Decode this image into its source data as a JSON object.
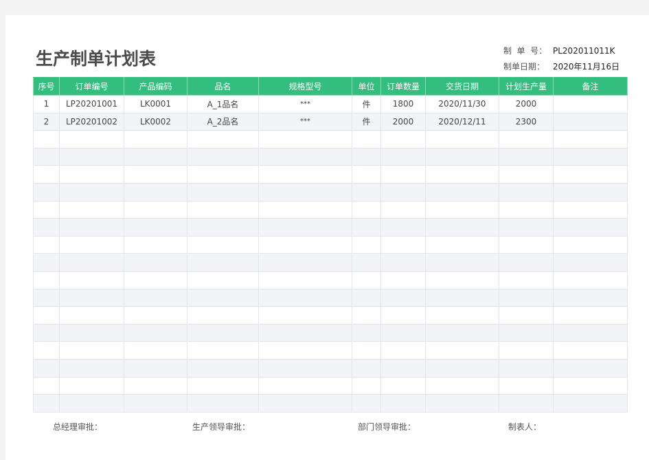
{
  "title": "生产制单计划表",
  "meta": {
    "order_no_label": "制  单  号：",
    "order_no": "PL202011011K",
    "date_label": "制单日期：",
    "date": "2020年11月16日"
  },
  "table": {
    "headers": [
      "序号",
      "订单编号",
      "产品编码",
      "品名",
      "规格型号",
      "单位",
      "订单数量",
      "交货日期",
      "计划生产量",
      "备注"
    ],
    "rows": [
      [
        "1",
        "LP20201001",
        "LK0001",
        "A_1品名",
        "***",
        "件",
        "1800",
        "2020/11/30",
        "2000",
        ""
      ],
      [
        "2",
        "LP20201002",
        "LK0002",
        "A_2品名",
        "***",
        "件",
        "2000",
        "2020/12/11",
        "2300",
        ""
      ],
      [
        "",
        "",
        "",
        "",
        "",
        "",
        "",
        "",
        "",
        ""
      ],
      [
        "",
        "",
        "",
        "",
        "",
        "",
        "",
        "",
        "",
        ""
      ],
      [
        "",
        "",
        "",
        "",
        "",
        "",
        "",
        "",
        "",
        ""
      ],
      [
        "",
        "",
        "",
        "",
        "",
        "",
        "",
        "",
        "",
        ""
      ],
      [
        "",
        "",
        "",
        "",
        "",
        "",
        "",
        "",
        "",
        ""
      ],
      [
        "",
        "",
        "",
        "",
        "",
        "",
        "",
        "",
        "",
        ""
      ],
      [
        "",
        "",
        "",
        "",
        "",
        "",
        "",
        "",
        "",
        ""
      ],
      [
        "",
        "",
        "",
        "",
        "",
        "",
        "",
        "",
        "",
        ""
      ],
      [
        "",
        "",
        "",
        "",
        "",
        "",
        "",
        "",
        "",
        ""
      ],
      [
        "",
        "",
        "",
        "",
        "",
        "",
        "",
        "",
        "",
        ""
      ],
      [
        "",
        "",
        "",
        "",
        "",
        "",
        "",
        "",
        "",
        ""
      ],
      [
        "",
        "",
        "",
        "",
        "",
        "",
        "",
        "",
        "",
        ""
      ],
      [
        "",
        "",
        "",
        "",
        "",
        "",
        "",
        "",
        "",
        ""
      ],
      [
        "",
        "",
        "",
        "",
        "",
        "",
        "",
        "",
        "",
        ""
      ],
      [
        "",
        "",
        "",
        "",
        "",
        "",
        "",
        "",
        "",
        ""
      ],
      [
        "",
        "",
        "",
        "",
        "",
        "",
        "",
        "",
        "",
        ""
      ]
    ]
  },
  "signatures": {
    "gm": "总经理审批：",
    "production_lead": "生产领导审批：",
    "dept_lead": "部门领导审批：",
    "preparer": "制表人："
  },
  "colors": {
    "header_bg": "#33bd7f",
    "stripe": "#f3f4f8"
  }
}
